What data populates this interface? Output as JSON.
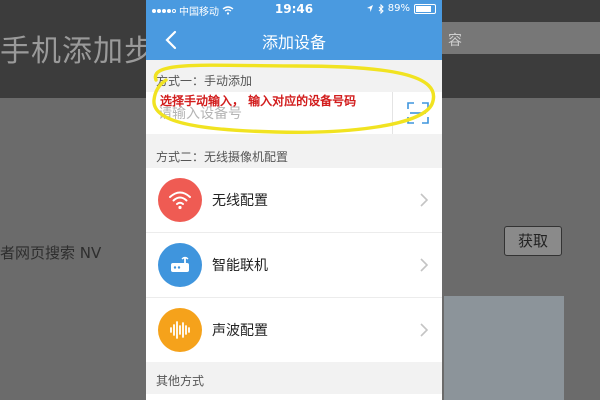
{
  "background": {
    "page_title": "手机添加步骤",
    "search_text": "容",
    "body_text": "者网页搜索 NV",
    "button_label": "获取"
  },
  "status_bar": {
    "carrier": "中国移动",
    "time": "19:46",
    "battery": "89%"
  },
  "nav": {
    "title": "添加设备",
    "back_icon": "chevron-left-icon"
  },
  "manual_section": {
    "label": "方式一：手动添加",
    "input_placeholder": "请输入设备号",
    "input_value": "",
    "scan_icon": "scan-icon",
    "annotation": "选择手动输入， 输入对应的设备号码",
    "annotation_color": "#d21d1d",
    "highlight_color": "#f1e321"
  },
  "wireless_section": {
    "label": "方式二：无线摄像机配置",
    "items": [
      {
        "label": "无线配置",
        "icon": "wifi-icon",
        "color": "#ef5b53"
      },
      {
        "label": "智能联机",
        "icon": "router-icon",
        "color": "#3f95dd"
      },
      {
        "label": "声波配置",
        "icon": "soundwave-icon",
        "color": "#f5a21b"
      }
    ]
  },
  "other_section": {
    "label": "其他方式"
  },
  "colors": {
    "accent": "#4a9ae0"
  }
}
